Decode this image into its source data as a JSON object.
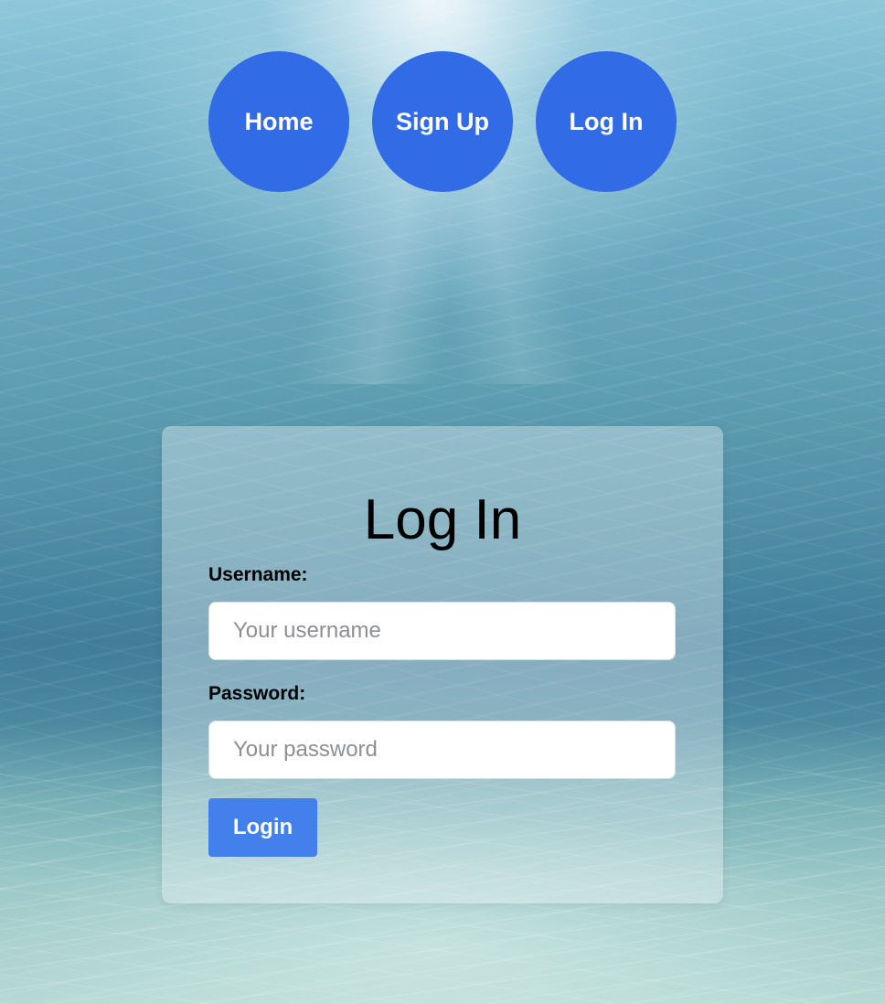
{
  "nav": {
    "items": [
      {
        "label": "Home"
      },
      {
        "label": "Sign Up"
      },
      {
        "label": "Log In"
      }
    ]
  },
  "login_form": {
    "title": "Log In",
    "username_label": "Username:",
    "username_placeholder": "Your username",
    "username_value": "",
    "password_label": "Password:",
    "password_placeholder": "Your password",
    "password_value": "",
    "submit_label": "Login"
  },
  "theme": {
    "nav_button_color": "#316be5",
    "login_button_color": "#4480ec",
    "background": "underwater-scene"
  }
}
